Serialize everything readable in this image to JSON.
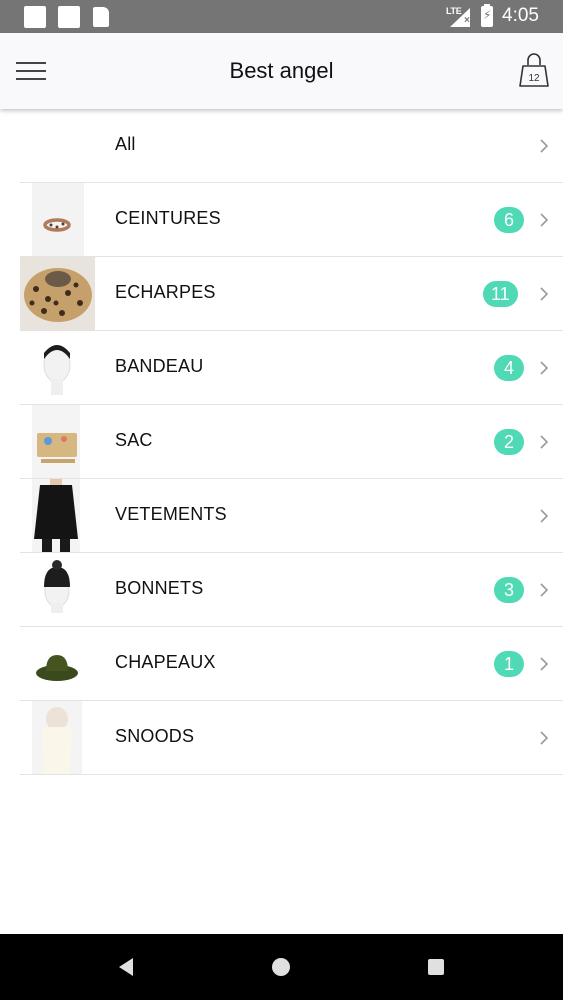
{
  "status_bar": {
    "time": "4:05",
    "network": "LTE",
    "icons": [
      "notification-icon",
      "notification-icon",
      "sd-card-icon",
      "signal-icon",
      "battery-charging-icon"
    ]
  },
  "app_bar": {
    "title": "Best angel",
    "menu_icon": "hamburger-menu-icon",
    "cart_icon": "shopping-bag-icon",
    "cart_count": "12"
  },
  "categories": [
    {
      "label": "All",
      "count": null,
      "thumb": "none"
    },
    {
      "label": "CEINTURES",
      "count": "6",
      "thumb": "belt"
    },
    {
      "label": "ECHARPES",
      "count": "11",
      "thumb": "leopard-scarf"
    },
    {
      "label": "BANDEAU",
      "count": "4",
      "thumb": "headband"
    },
    {
      "label": "SAC",
      "count": "2",
      "thumb": "bag"
    },
    {
      "label": "VETEMENTS",
      "count": null,
      "thumb": "coat"
    },
    {
      "label": "BONNETS",
      "count": "3",
      "thumb": "beanie"
    },
    {
      "label": "CHAPEAUX",
      "count": "1",
      "thumb": "hat"
    },
    {
      "label": "SNOODS",
      "count": null,
      "thumb": "snood"
    }
  ],
  "colors": {
    "badge": "#4fd9b4",
    "status_bar": "#757575",
    "app_bar": "#f9f8fb",
    "divider": "#e3e3e3"
  },
  "nav_bar": {
    "icons": [
      "back-icon",
      "home-icon",
      "recent-apps-icon"
    ]
  }
}
